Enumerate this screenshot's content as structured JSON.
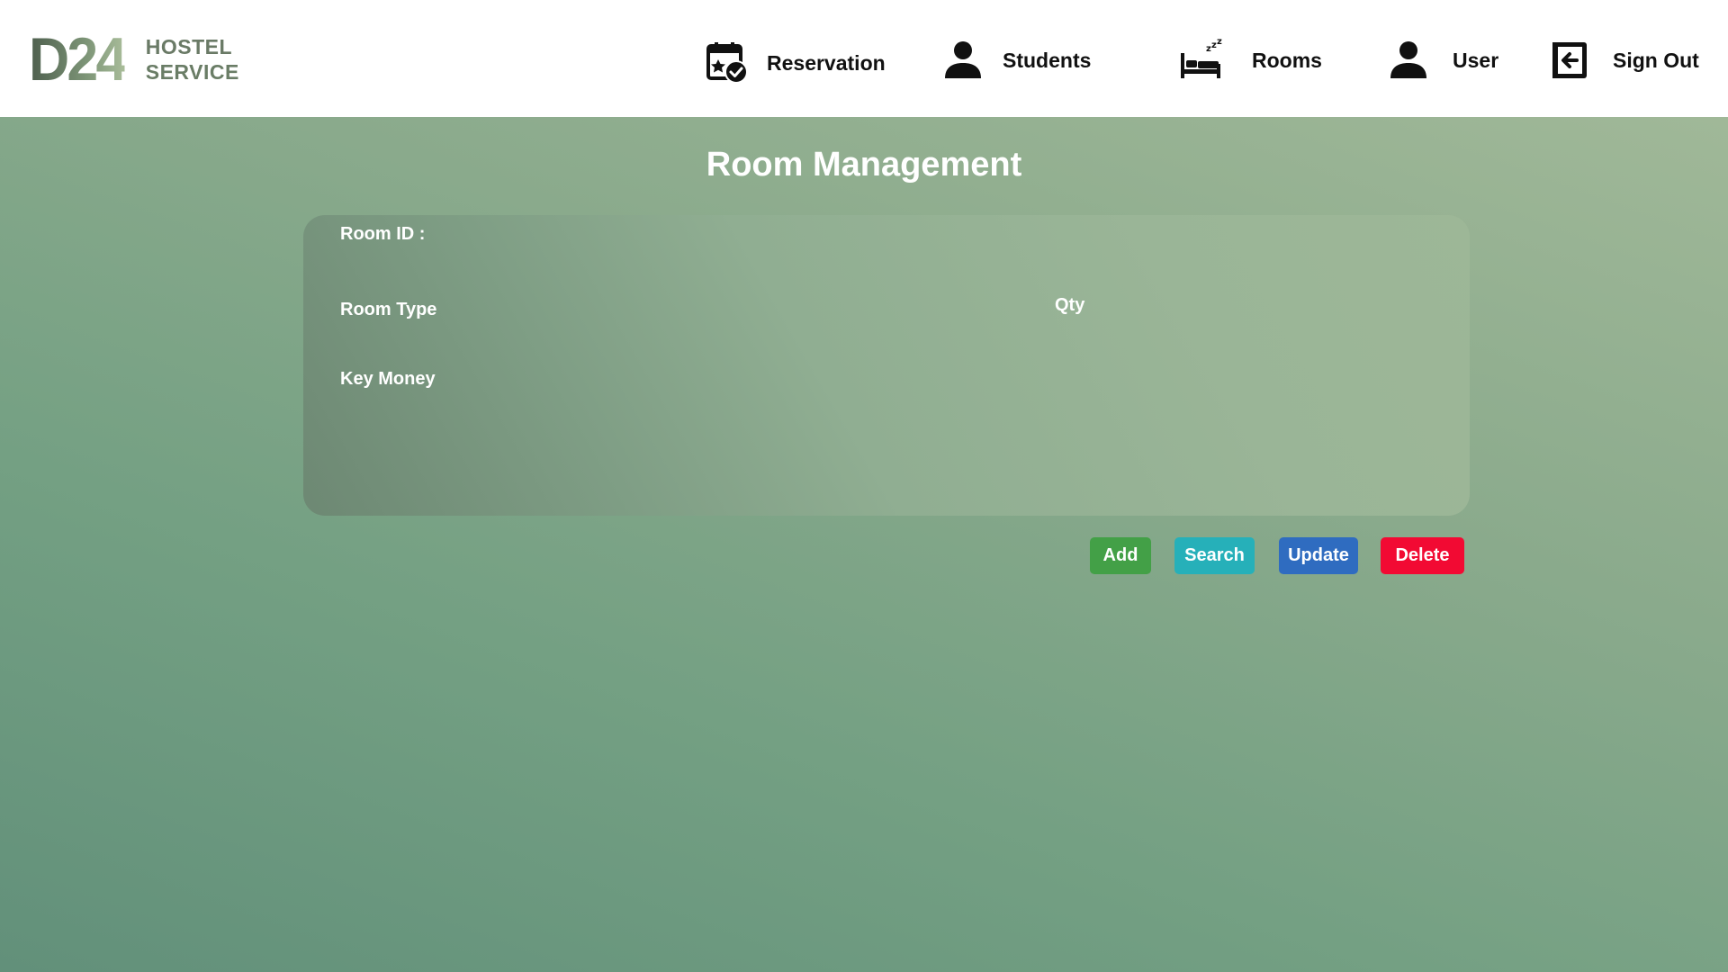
{
  "header": {
    "logo": {
      "mark": "D24",
      "line1": "HOSTEL",
      "line2": "SERVICE"
    },
    "nav": [
      {
        "label": "Reservation",
        "icon": "reservation-check-icon"
      },
      {
        "label": "Students",
        "icon": "person-icon"
      },
      {
        "label": "Rooms",
        "icon": "bed-sleep-icon"
      },
      {
        "label": "User",
        "icon": "person-icon"
      },
      {
        "label": "Sign Out",
        "icon": "sign-out-icon"
      }
    ]
  },
  "main": {
    "title": "Room Management",
    "form": {
      "room_id_label": "Room ID :",
      "room_type_label": "Room Type",
      "qty_label": "Qty",
      "key_money_label": "Key Money"
    },
    "buttons": {
      "add": "Add",
      "search": "Search",
      "update": "Update",
      "delete": "Delete"
    }
  },
  "colors": {
    "add": "#43a047",
    "search": "#26b0b9",
    "update": "#2f6cc0",
    "delete": "#f20a33"
  }
}
